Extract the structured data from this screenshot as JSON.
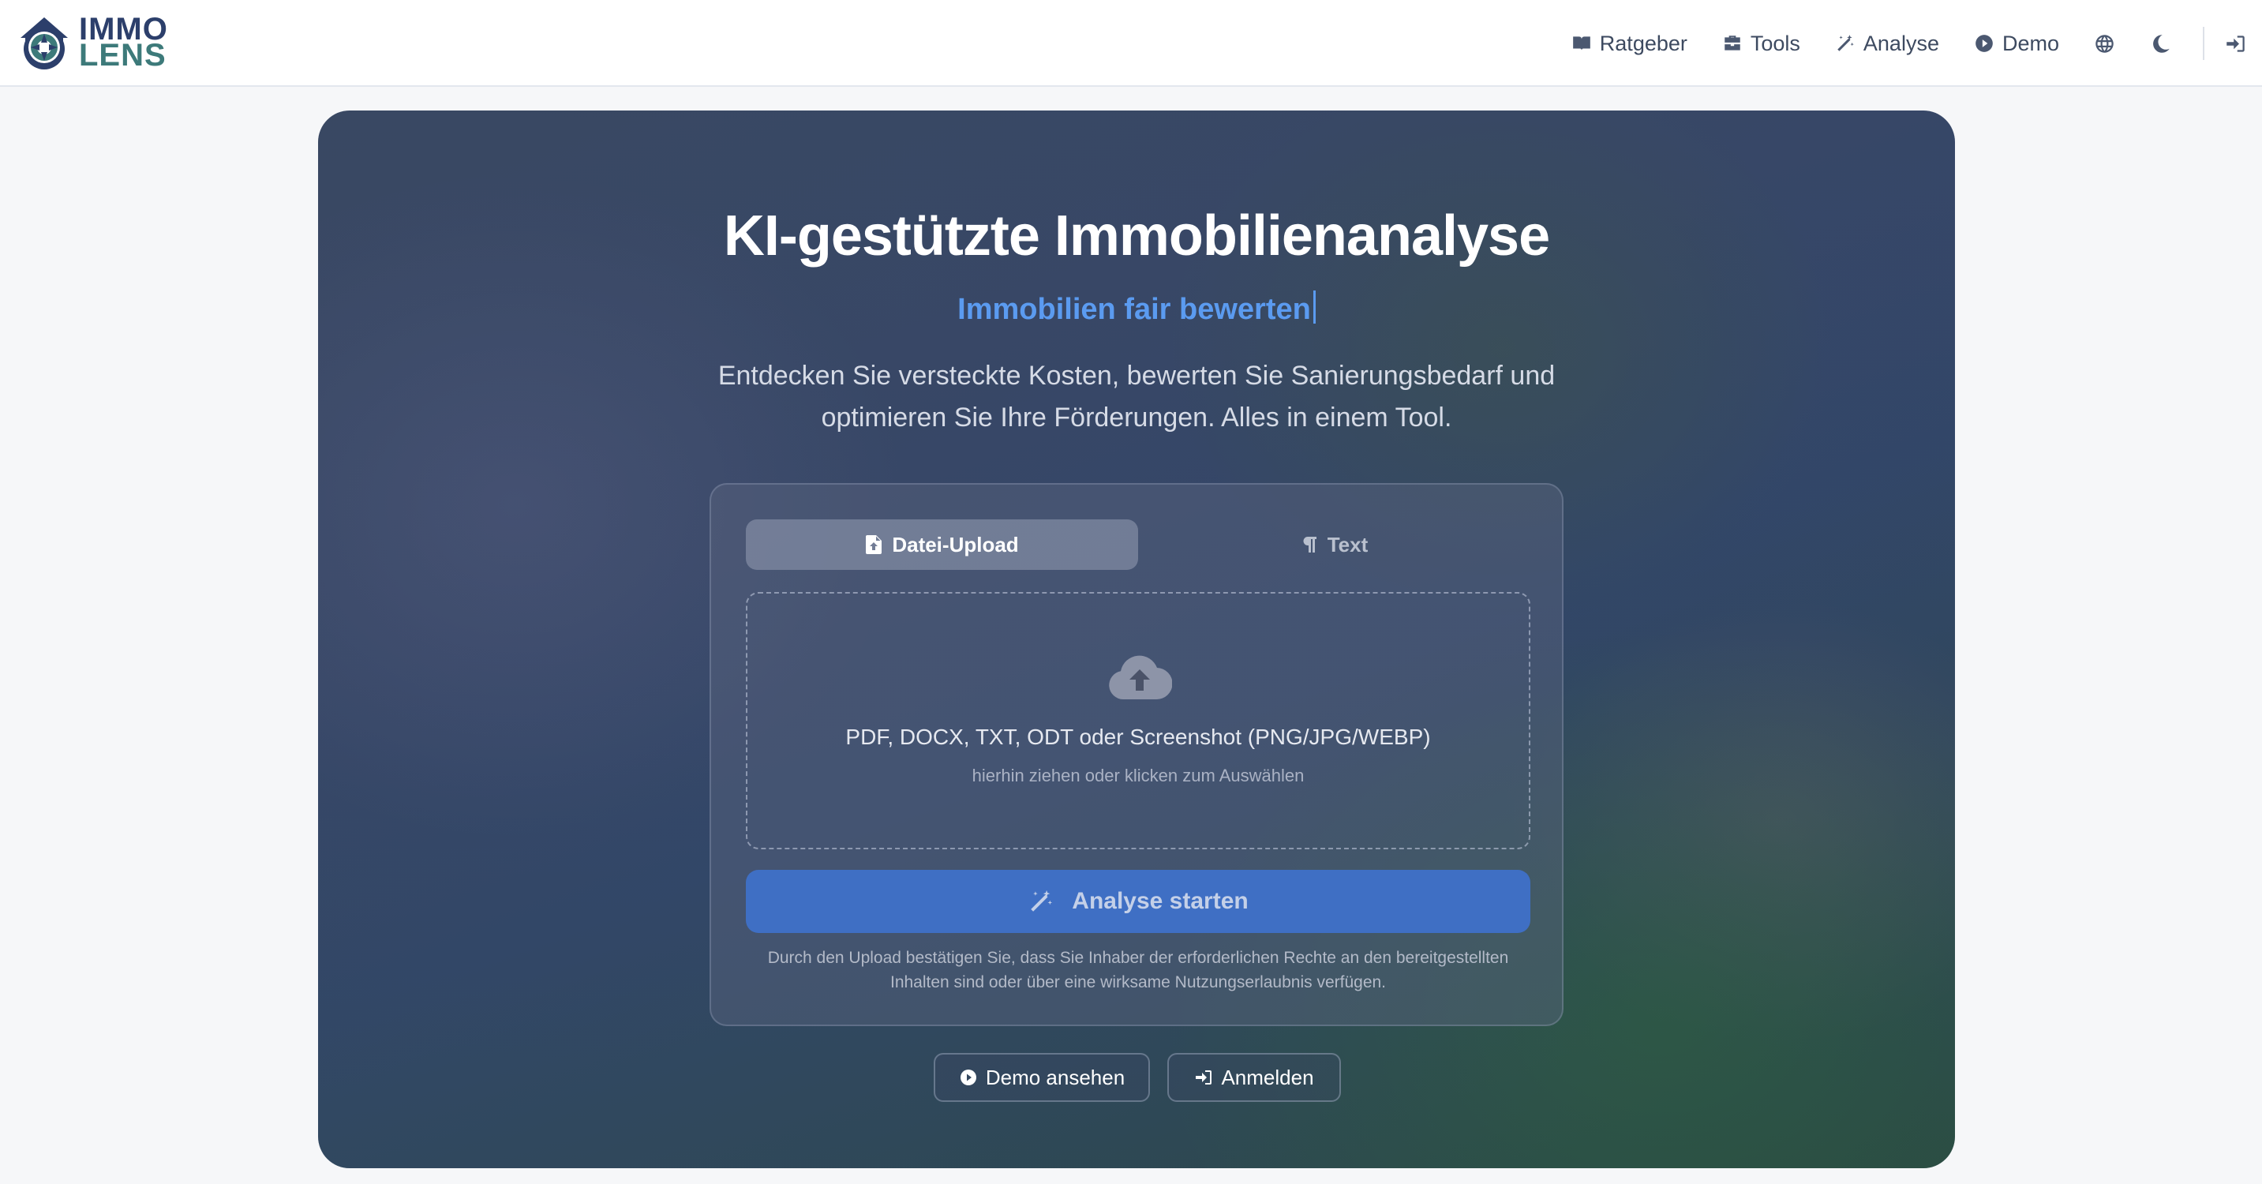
{
  "brand": {
    "line1": "IMMO",
    "line2": "LENS",
    "colors": {
      "primary": "#2c3f6b",
      "secondary": "#3d7a7a"
    }
  },
  "nav": {
    "items": [
      {
        "label": "Ratgeber",
        "icon": "book-open-icon"
      },
      {
        "label": "Tools",
        "icon": "toolbox-icon"
      },
      {
        "label": "Analyse",
        "icon": "magic-wand-icon"
      },
      {
        "label": "Demo",
        "icon": "play-circle-icon"
      }
    ],
    "icons": [
      "globe-icon",
      "moon-icon",
      "sign-in-icon"
    ]
  },
  "hero": {
    "title": "KI-gestützte Immobilienanalyse",
    "subtitle": "Immobilien fair bewerten",
    "description": "Entdecken Sie versteckte Kosten, bewerten Sie Sanierungsbedarf und optimieren Sie Ihre Förderungen. Alles in einem Tool."
  },
  "card": {
    "tabs": [
      {
        "label": "Datei-Upload",
        "icon": "file-upload-icon",
        "active": true
      },
      {
        "label": "Text",
        "icon": "paragraph-icon",
        "active": false
      }
    ],
    "dropzone": {
      "icon": "cloud-upload-icon",
      "main": "PDF, DOCX, TXT, ODT oder Screenshot (PNG/JPG/WEBP)",
      "hint": "hierhin ziehen oder klicken zum Auswählen"
    },
    "start_button": "Analyse starten",
    "legal": "Durch den Upload bestätigen Sie, dass Sie Inhaber der erforderlichen Rechte an den bereitgestellten Inhalten sind oder über eine wirksame Nutzungserlaubnis verfügen."
  },
  "actions": {
    "demo": "Demo ansehen",
    "login": "Anmelden"
  },
  "colors": {
    "accent": "#3f6fc4",
    "subtitle": "#5b9bf0"
  }
}
